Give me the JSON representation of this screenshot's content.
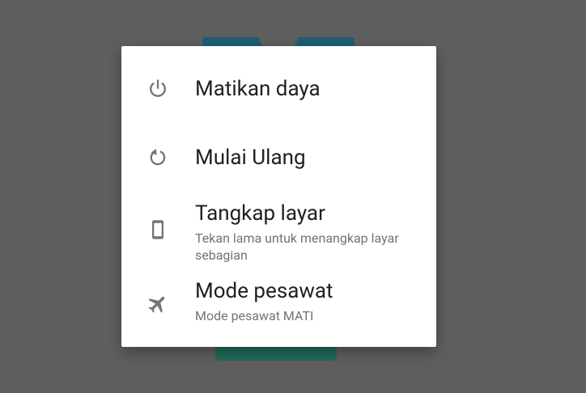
{
  "dialog": {
    "items": [
      {
        "icon": "power-icon",
        "title": "Matikan daya"
      },
      {
        "icon": "restart-icon",
        "title": "Mulai Ulang"
      },
      {
        "icon": "phone-screenshot-icon",
        "title": "Tangkap layar",
        "subtitle": "Tekan lama untuk menangkap layar sebagian"
      },
      {
        "icon": "airplane-icon",
        "title": "Mode pesawat",
        "subtitle": "Mode pesawat MATI"
      }
    ]
  },
  "colors": {
    "scrim": "#5f5f5f",
    "dialog_bg": "#ffffff",
    "title_text": "#212121",
    "subtitle_text": "#737373",
    "icon": "#757575"
  }
}
